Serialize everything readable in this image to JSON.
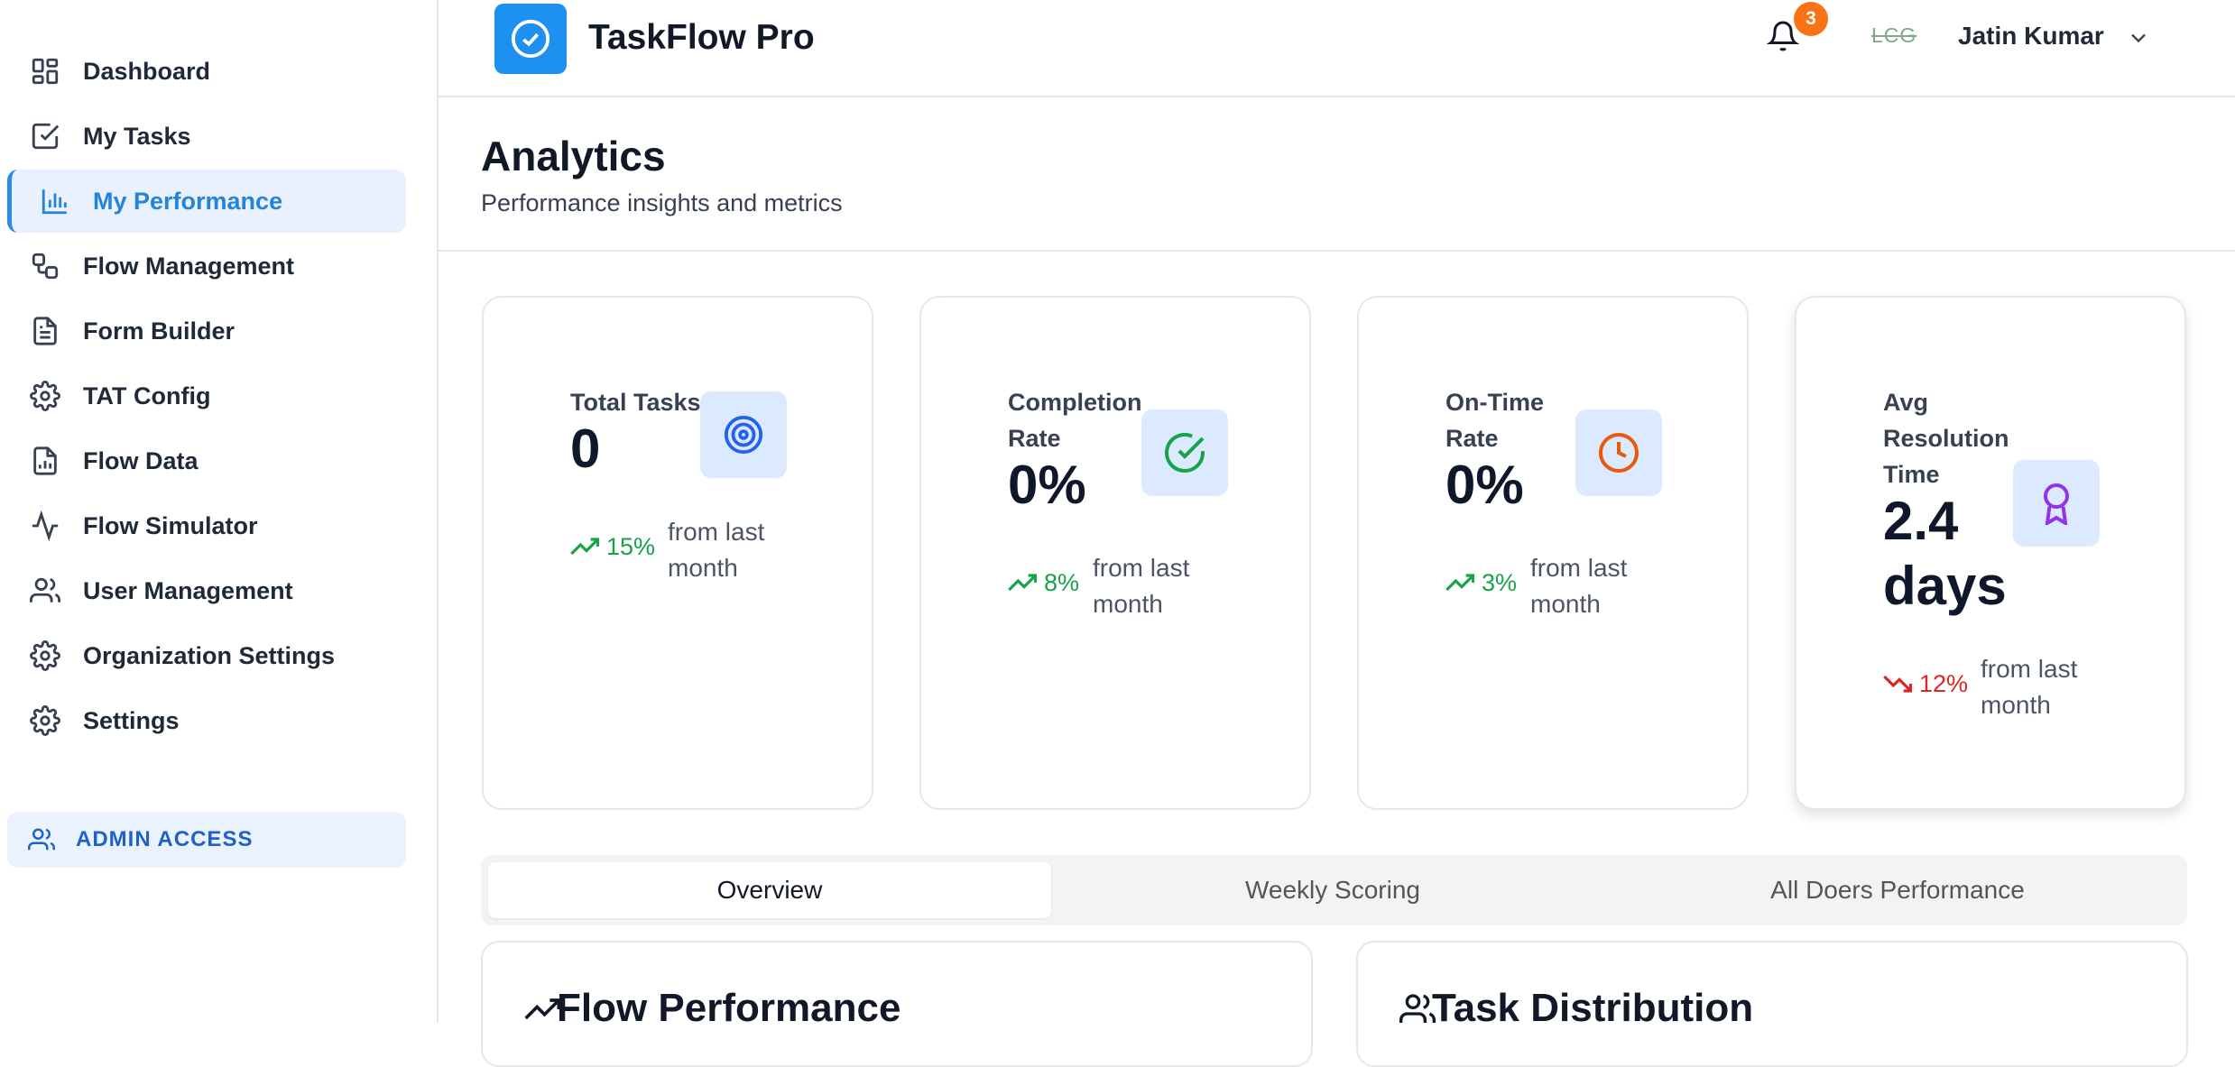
{
  "sidebar": {
    "items": [
      {
        "label": "Dashboard",
        "icon": "grid-icon"
      },
      {
        "label": "My Tasks",
        "icon": "checkbox-icon"
      },
      {
        "label": "My Performance",
        "icon": "bar-chart-icon",
        "active": true
      },
      {
        "label": "Flow Management",
        "icon": "workflow-icon"
      },
      {
        "label": "Form Builder",
        "icon": "document-icon"
      },
      {
        "label": "TAT Config",
        "icon": "gear-icon"
      },
      {
        "label": "Flow Data",
        "icon": "file-chart-icon"
      },
      {
        "label": "Flow Simulator",
        "icon": "activity-icon"
      },
      {
        "label": "User Management",
        "icon": "users-icon"
      },
      {
        "label": "Organization Settings",
        "icon": "gear-icon"
      },
      {
        "label": "Settings",
        "icon": "gear-icon"
      }
    ],
    "admin_label": "ADMIN ACCESS"
  },
  "header": {
    "app_title": "TaskFlow Pro",
    "notification_count": "3",
    "org_logo_text": "LCG",
    "user_name": "Jatin Kumar"
  },
  "page": {
    "title": "Analytics",
    "subtitle": "Performance insights and metrics"
  },
  "cards": [
    {
      "label_lines": [
        "Total Tasks"
      ],
      "value_lines": [
        "0"
      ],
      "trend": "15%",
      "trend_direction": "up",
      "note_lines": [
        "from last",
        "month"
      ],
      "icon": "target-icon",
      "icon_color": "#2563eb"
    },
    {
      "label_lines": [
        "Completion",
        "Rate"
      ],
      "value_lines": [
        "0%"
      ],
      "trend": "8%",
      "trend_direction": "up",
      "note_lines": [
        "from last",
        "month"
      ],
      "icon": "check-circle-icon",
      "icon_color": "#16a34a"
    },
    {
      "label_lines": [
        "On-Time",
        "Rate"
      ],
      "value_lines": [
        "0%"
      ],
      "trend": "3%",
      "trend_direction": "up",
      "note_lines": [
        "from last",
        "month"
      ],
      "icon": "clock-icon",
      "icon_color": "#ea580c"
    },
    {
      "label_lines": [
        "Avg",
        "Resolution",
        "Time"
      ],
      "value_lines": [
        "2.4",
        "days"
      ],
      "trend": "12%",
      "trend_direction": "down",
      "note_lines": [
        "from last",
        "month"
      ],
      "icon": "award-icon",
      "icon_color": "#9333ea"
    }
  ],
  "colors": {
    "up": "#16a34a",
    "down": "#dc2626",
    "accent": "#2484d8"
  },
  "tabs": [
    {
      "label": "Overview",
      "active": true
    },
    {
      "label": "Weekly Scoring",
      "active": false
    },
    {
      "label": "All Doers Performance",
      "active": false
    }
  ],
  "panels": [
    {
      "title": "Flow Performance",
      "icon": "trending-up-icon"
    },
    {
      "title": "Task Distribution",
      "icon": "users-icon"
    }
  ]
}
